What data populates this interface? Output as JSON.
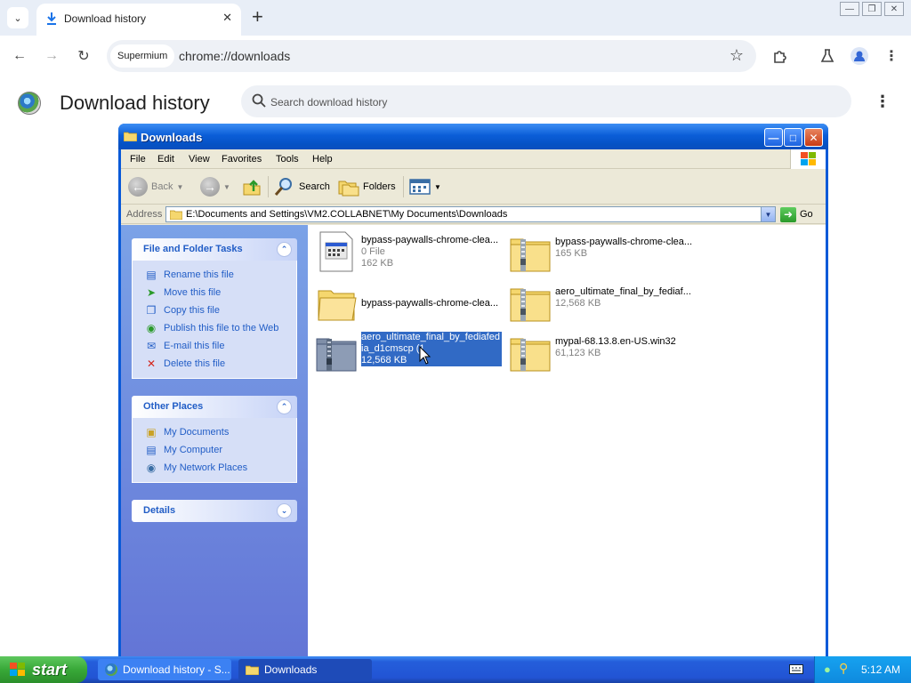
{
  "browser": {
    "tab_title": "Download history",
    "omnibox_chip": "Supermium",
    "url": "chrome://downloads"
  },
  "downloads_page": {
    "title": "Download history",
    "search_placeholder": "Search download history"
  },
  "explorer": {
    "window_title": "Downloads",
    "menu": [
      "File",
      "Edit",
      "View",
      "Favorites",
      "Tools",
      "Help"
    ],
    "toolbar": {
      "back": "Back",
      "search": "Search",
      "folders": "Folders"
    },
    "address": {
      "label": "Address",
      "path": "E:\\Documents and Settings\\VM2.COLLABNET\\My Documents\\Downloads",
      "go": "Go"
    },
    "file_tasks": {
      "title": "File and Folder Tasks",
      "items": [
        "Rename this file",
        "Move this file",
        "Copy this file",
        "Publish this file to the Web",
        "E-mail this file",
        "Delete this file"
      ]
    },
    "other_places": {
      "title": "Other Places",
      "items": [
        "My Documents",
        "My Computer",
        "My Network Places"
      ]
    },
    "details": {
      "title": "Details"
    },
    "files": [
      {
        "name": "bypass-paywalls-chrome-clea...",
        "type": "0 File",
        "size": "162 KB",
        "icon": "generic-file-icon"
      },
      {
        "name": "bypass-paywalls-chrome-clea...",
        "type": "",
        "size": "165 KB",
        "icon": "zip-folder-icon"
      },
      {
        "name": "bypass-paywalls-chrome-clea...",
        "type": "",
        "size": "",
        "icon": "folder-icon"
      },
      {
        "name": "aero_ultimate_final_by_fediaf...",
        "type": "",
        "size": "12,568 KB",
        "icon": "zip-folder-icon"
      },
      {
        "name": "aero_ultimate_final_by_fediafed ia_d1cmscp (1",
        "type": "",
        "size": "12,568 KB",
        "icon": "zip-folder-icon",
        "selected": true
      },
      {
        "name": "mypal-68.13.8.en-US.win32",
        "type": "",
        "size": "61,123 KB",
        "icon": "zip-folder-icon"
      }
    ]
  },
  "taskbar": {
    "start": "start",
    "tasks": [
      "Download history - S...",
      "Downloads"
    ],
    "clock": "5:12 AM"
  }
}
